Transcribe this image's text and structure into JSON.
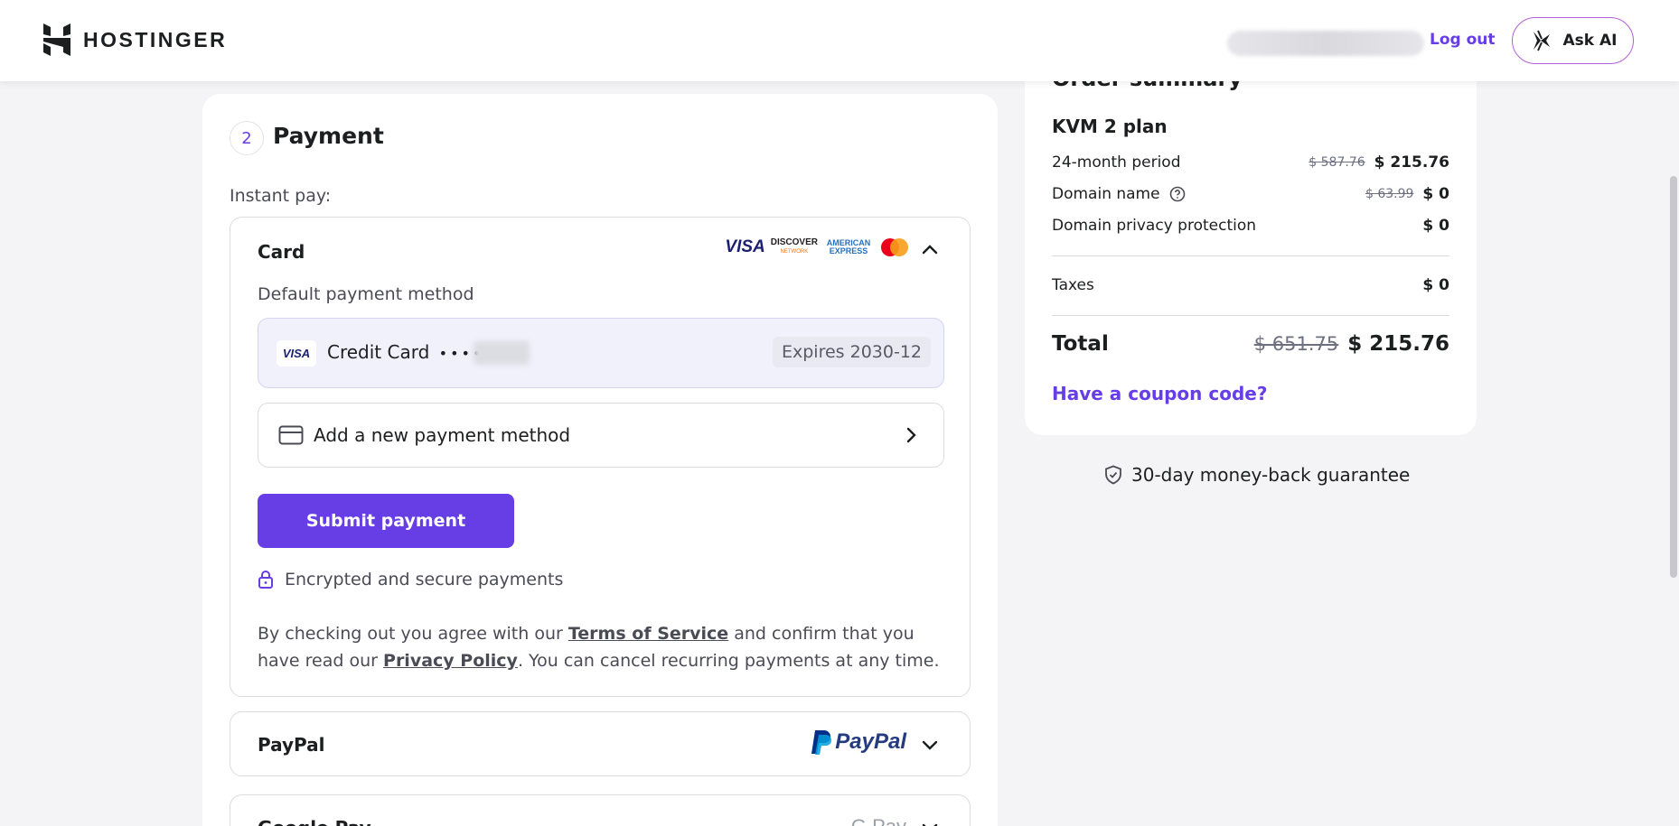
{
  "header": {
    "logo_text": "HOSTINGER",
    "logout_label": "Log out",
    "ask_ai_label": "Ask AI"
  },
  "payment": {
    "step_number": "2",
    "title": "Payment",
    "instant_pay_label": "Instant pay:",
    "card": {
      "title": "Card",
      "brand_logos": [
        "VISA",
        "DISCOVER",
        "AMERICAN EXPRESS",
        "mastercard"
      ],
      "discover_sub": "NETWORK",
      "default_label": "Default payment method",
      "saved_card": {
        "badge": "VISA",
        "label": "Credit Card",
        "dots": "••••",
        "expires": "Expires 2030-12"
      },
      "add_method_label": "Add a new payment method",
      "submit_label": "Submit payment",
      "secure_label": "Encrypted and secure payments",
      "terms": {
        "pre": "By checking out you agree with our ",
        "tos_link": "Terms of Service",
        "mid": " and confirm that you have read our ",
        "privacy_link": "Privacy Policy",
        "post": ". You can cancel recurring payments at any time."
      }
    },
    "paypal": {
      "title": "PayPal",
      "logo_text": "PayPal"
    },
    "google_pay": {
      "title": "Google Pay",
      "logo_text": "G Pay"
    }
  },
  "summary": {
    "title": "Order summary",
    "plan_name": "KVM 2 plan",
    "rows": [
      {
        "label": "24-month period",
        "old_price": "$ 587.76",
        "price": "$ 215.76"
      },
      {
        "label": "Domain name",
        "old_price": "$ 63.99",
        "price": "$ 0"
      },
      {
        "label": "Domain privacy protection",
        "old_price": "",
        "price": "$ 0"
      }
    ],
    "taxes_label": "Taxes",
    "taxes_price": "$ 0",
    "total_label": "Total",
    "total_old": "$ 651.75",
    "total_new": "$ 215.76",
    "coupon_label": "Have a coupon code?"
  },
  "guarantee_label": "30-day money-back guarantee",
  "colors": {
    "accent": "#673de6",
    "text": "#1d1e20",
    "muted": "#6d7081"
  }
}
